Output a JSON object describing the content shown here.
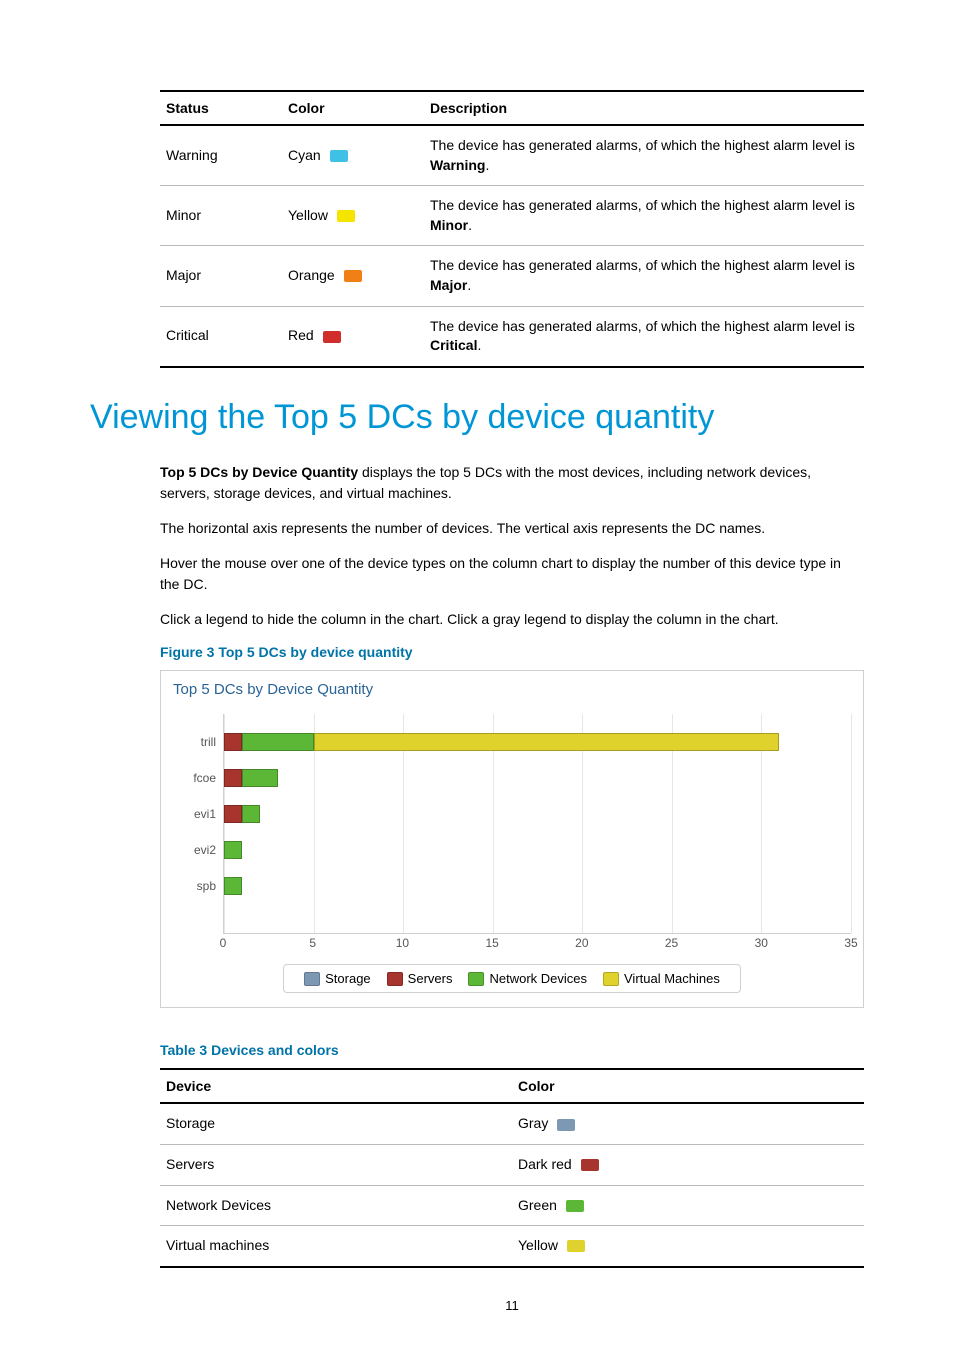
{
  "table1": {
    "headers": [
      "Status",
      "Color",
      "Description"
    ],
    "rows": [
      {
        "status": "Warning",
        "color_name": "Cyan",
        "swatch": "#3fc1e6",
        "desc_prefix": "The device has generated alarms, of which the highest alarm level is ",
        "desc_bold": "Warning",
        "desc_suffix": "."
      },
      {
        "status": "Minor",
        "color_name": "Yellow",
        "swatch": "#f4e400",
        "desc_prefix": "The device has generated alarms, of which the highest alarm level is ",
        "desc_bold": "Minor",
        "desc_suffix": "."
      },
      {
        "status": "Major",
        "color_name": "Orange",
        "swatch": "#f08016",
        "desc_prefix": "The device has generated alarms, of which the highest alarm level is ",
        "desc_bold": "Major",
        "desc_suffix": "."
      },
      {
        "status": "Critical",
        "color_name": "Red",
        "swatch": "#d22d2d",
        "desc_prefix": "The device has generated alarms, of which the highest alarm level is ",
        "desc_bold": "Critical",
        "desc_suffix": "."
      }
    ]
  },
  "heading": "Viewing the Top 5 DCs by device quantity",
  "para1_bold": "Top 5 DCs by Device Quantity",
  "para1_rest": " displays the top 5 DCs with the most devices, including network devices, servers, storage devices, and virtual machines.",
  "para2": "The horizontal axis represents the number of devices. The vertical axis represents the DC names.",
  "para3": "Hover the mouse over one of the device types on the column chart to display the number of this device type in the DC.",
  "para4": "Click a legend to hide the column in the chart. Click a gray legend to display the column in the chart.",
  "figure_caption": "Figure 3 Top 5 DCs by device quantity",
  "table3_caption": "Table 3 Devices and colors",
  "table3": {
    "headers": [
      "Device",
      "Color"
    ],
    "rows": [
      {
        "device": "Storage",
        "color_name": "Gray",
        "swatch": "#7d98b3"
      },
      {
        "device": "Servers",
        "color_name": "Dark red",
        "swatch": "#a7352d"
      },
      {
        "device": "Network Devices",
        "color_name": "Green",
        "swatch": "#5cb736"
      },
      {
        "device": "Virtual machines",
        "color_name": "Yellow",
        "swatch": "#e0d22c"
      }
    ]
  },
  "page_number": "11",
  "chart_data": {
    "type": "bar",
    "orientation": "horizontal",
    "title": "Top 5 DCs by Device Quantity",
    "xlabel": "",
    "ylabel": "",
    "xlim": [
      0,
      35
    ],
    "xticks": [
      0,
      5,
      10,
      15,
      20,
      25,
      30,
      35
    ],
    "categories": [
      "trill",
      "fcoe",
      "evi1",
      "evi2",
      "spb"
    ],
    "series": [
      {
        "name": "Storage",
        "color": "#7d98b3",
        "values": [
          0,
          0,
          0,
          0,
          0
        ]
      },
      {
        "name": "Servers",
        "color": "#a7352d",
        "values": [
          1,
          1,
          1,
          0,
          0
        ]
      },
      {
        "name": "Network Devices",
        "color": "#5cb736",
        "values": [
          4,
          2,
          1,
          1,
          1
        ]
      },
      {
        "name": "Virtual Machines",
        "color": "#e0d22c",
        "values": [
          26,
          0,
          0,
          0,
          0
        ]
      }
    ],
    "legend_position": "bottom"
  }
}
